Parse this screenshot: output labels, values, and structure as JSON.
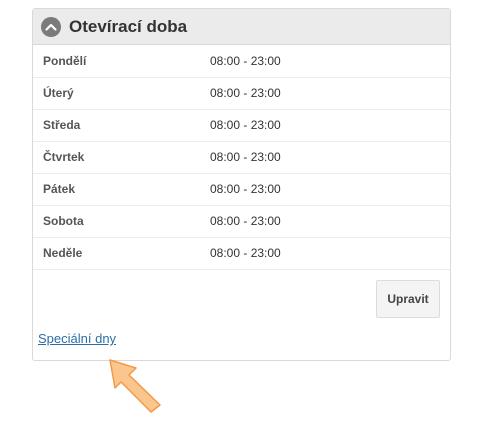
{
  "panel": {
    "title": "Otevírací doba",
    "collapse_icon": "chevron-up-icon"
  },
  "hours": [
    {
      "day": "Pondělí",
      "time": "08:00 - 23:00"
    },
    {
      "day": "Úterý",
      "time": "08:00 - 23:00"
    },
    {
      "day": "Středa",
      "time": "08:00 - 23:00"
    },
    {
      "day": "Čtvrtek",
      "time": "08:00 - 23:00"
    },
    {
      "day": "Pátek",
      "time": "08:00 - 23:00"
    },
    {
      "day": "Sobota",
      "time": "08:00 - 23:00"
    },
    {
      "day": "Neděle",
      "time": "08:00 - 23:00"
    }
  ],
  "actions": {
    "edit_label": "Upravit"
  },
  "special_days_link": "Speciální dny",
  "colors": {
    "link": "#2b6ea8",
    "arrow_fill": "#fbc68e",
    "arrow_stroke": "#f29a47"
  }
}
